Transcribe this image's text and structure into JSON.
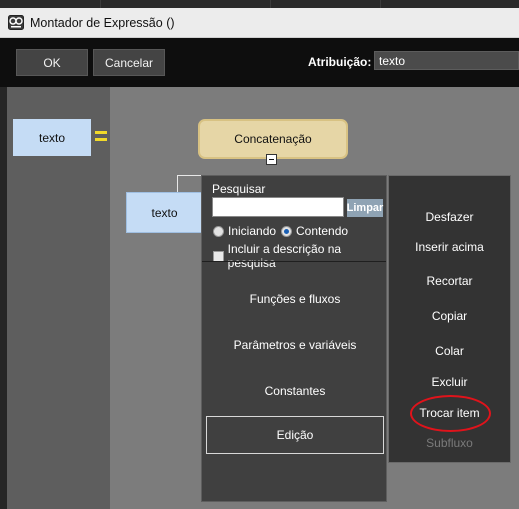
{
  "window": {
    "title": "Montador de Expressão ()"
  },
  "toolbar": {
    "ok_label": "OK",
    "cancel_label": "Cancelar",
    "assignment_label": "Atribuição:",
    "assignment_value": "texto"
  },
  "canvas": {
    "target_variable": "texto",
    "concat_node": "Concatenação",
    "child_node": "texto"
  },
  "search": {
    "label": "Pesquisar",
    "query": "",
    "clear_label": "Limpar",
    "match_starting": "Iniciando",
    "match_containing": "Contendo",
    "selected_match": "Contendo",
    "include_description": "Incluir a descrição na pesquisa",
    "include_description_checked": false
  },
  "categories": [
    {
      "label": "Funções e fluxos"
    },
    {
      "label": "Parâmetros e variáveis"
    },
    {
      "label": "Constantes"
    },
    {
      "label": "Edição",
      "selected": true
    }
  ],
  "context_menu": [
    {
      "label": "Desfazer",
      "enabled": true
    },
    {
      "label": "Inserir acima",
      "enabled": true
    },
    {
      "label": "Recortar",
      "enabled": true
    },
    {
      "label": "Copiar",
      "enabled": true
    },
    {
      "label": "Colar",
      "enabled": true
    },
    {
      "label": "Excluir",
      "enabled": true
    },
    {
      "label": "Trocar item",
      "enabled": true,
      "highlighted": true
    },
    {
      "label": "Subfluxo",
      "enabled": false
    }
  ],
  "colors": {
    "highlight_oval": "#e0131b",
    "node_blue": "#c5dcf5",
    "concat_node": "#e6d6a6",
    "equals_sign": "#f1d92a"
  }
}
